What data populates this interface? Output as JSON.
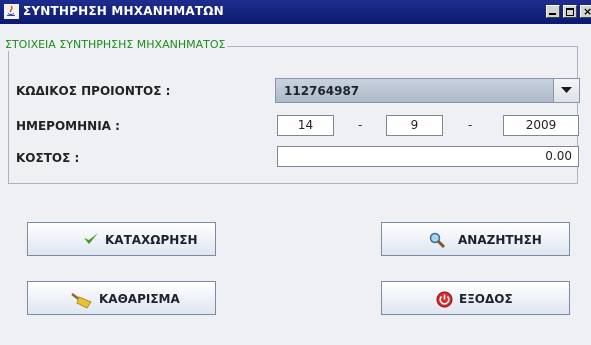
{
  "window": {
    "title": "ΣΥΝΤΗΡΗΣΗ ΜΗΧΑΝΗΜΑΤΩΝ"
  },
  "group": {
    "legend": "ΣΤΟΙΧΕΙΑ ΣΥΝΤΗΡΗΣΗΣ ΜΗΧΑΝΗΜΑΤΟΣ"
  },
  "form": {
    "product_code_label": "ΚΩΔΙΚΟΣ ΠΡΟΙΟΝΤΟΣ :",
    "product_code_value": "112764987",
    "date_label": "ΗΜΕΡΟΜΗΝΙΑ :",
    "date_day": "14",
    "date_month": "9",
    "date_year": "2009",
    "date_separator": "-",
    "cost_label": "ΚΟΣΤΟΣ :",
    "cost_value": "0.00"
  },
  "buttons": {
    "register": {
      "label": "ΚΑΤΑΧΩΡΗΣΗ",
      "icon": "checkmark-icon"
    },
    "search": {
      "label": "ΑΝΑΖΗΤΗΣΗ",
      "icon": "magnifier-icon"
    },
    "clear": {
      "label": "ΚΑΘΑΡΙΣΜΑ",
      "icon": "broom-icon"
    },
    "exit": {
      "label": "ΕΞΟΔΟΣ",
      "icon": "exit-icon"
    }
  },
  "colors": {
    "titlebar": "#0b1a6e",
    "legend": "#1a8c1a"
  }
}
